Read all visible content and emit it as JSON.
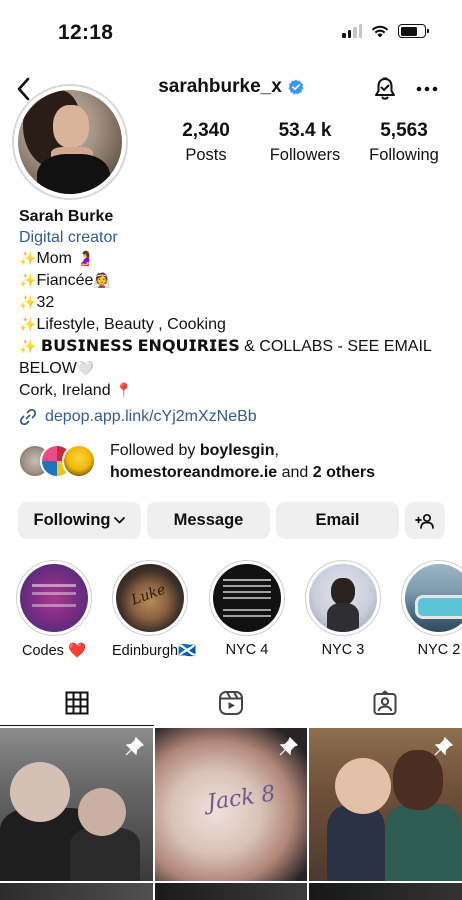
{
  "status_bar": {
    "time": "12:18",
    "battery_level": 0.7,
    "signal_bars_active": 2,
    "icons": [
      "signal-icon",
      "wifi-icon",
      "battery-icon"
    ]
  },
  "header": {
    "username": "sarahburke_x",
    "verified": true,
    "icons": [
      "back-chevron-icon",
      "verified-badge-icon",
      "notification-bell-icon",
      "more-options-icon"
    ]
  },
  "stats": [
    {
      "value": "2,340",
      "label": "Posts"
    },
    {
      "value": "53.4 k",
      "label": "Followers"
    },
    {
      "value": "5,563",
      "label": "Following"
    }
  ],
  "bio": {
    "name": "Sarah Burke",
    "category": "Digital creator",
    "lines": [
      {
        "sparkle": "✨",
        "text": "Mom",
        "emoji": "🤰"
      },
      {
        "sparkle": "✨",
        "text": "Fiancée",
        "emoji": "👰"
      },
      {
        "sparkle": "✨",
        "text": "32",
        "emoji": ""
      },
      {
        "sparkle": "✨",
        "text": "Lifestyle, Beauty , Cooking",
        "emoji": ""
      }
    ],
    "business_bold": "𝗕𝗨𝗦𝗜𝗡𝗘𝗦𝗦 𝗘𝗡𝗤𝗨𝗜𝗥𝗜𝗘𝗦",
    "business_rest": " & COLLABS - SEE EMAIL",
    "below": "BELOW",
    "below_emoji": "🤍",
    "location": "Cork, Ireland",
    "location_emoji": "📍",
    "link": "depop.app.link/cYj2mXzNeBb"
  },
  "followed_by": {
    "prefix": "Followed by ",
    "user1": "boylesgin",
    "comma": ",",
    "user2": "homestoreandmore.ie",
    "middle": " and ",
    "others": "2 others"
  },
  "actions": {
    "following": "Following",
    "message": "Message",
    "email": "Email"
  },
  "highlights": [
    {
      "label": "Codes ❤️"
    },
    {
      "label": "Edinburgh🏴󠁧󠁢󠁳󠁣󠁴󠁿"
    },
    {
      "label": "NYC 4"
    },
    {
      "label": "NYC 3"
    },
    {
      "label": "NYC 2"
    }
  ],
  "tabs": [
    "grid-tab",
    "reels-tab",
    "tagged-tab"
  ],
  "colors": {
    "link_blue": "#325b91",
    "verified_blue": "#3897f0",
    "button_gray": "#efefef"
  }
}
